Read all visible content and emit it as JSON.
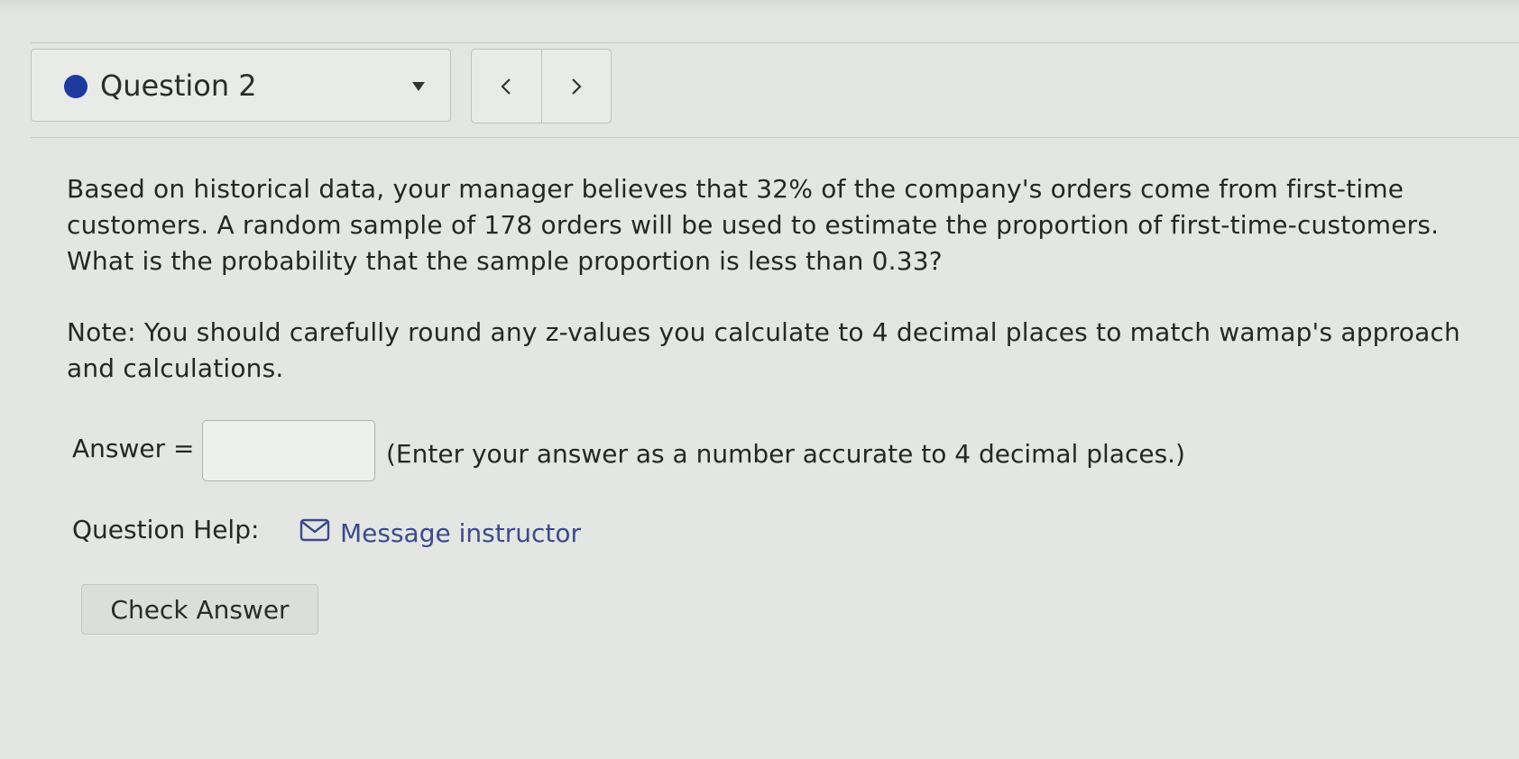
{
  "question_nav": {
    "selected_question": "Question 2",
    "status_color": "#1f3a9e",
    "dropdown_icon": "caret-down-icon",
    "prev_icon": "chevron-left-icon",
    "next_icon": "chevron-right-icon"
  },
  "question": {
    "text": "Based on historical data, your manager believes that 32% of the company's orders come from first-time\ncustomers. A random sample of 178 orders will be used to estimate the proportion of first-time-customers.\nWhat is the probability that the sample proportion is less than 0.33?",
    "note": "Note: You should carefully round any z-values you calculate to 4 decimal places to match wamap's approach\nand calculations."
  },
  "answer": {
    "label": "Answer =",
    "value": "",
    "hint": "(Enter your answer as a number accurate to 4 decimal places.)"
  },
  "help": {
    "label": "Question Help:",
    "icon": "mail-icon",
    "link_text": "Message instructor",
    "link_color": "#3a4a8a"
  },
  "actions": {
    "check_label": "Check Answer"
  }
}
